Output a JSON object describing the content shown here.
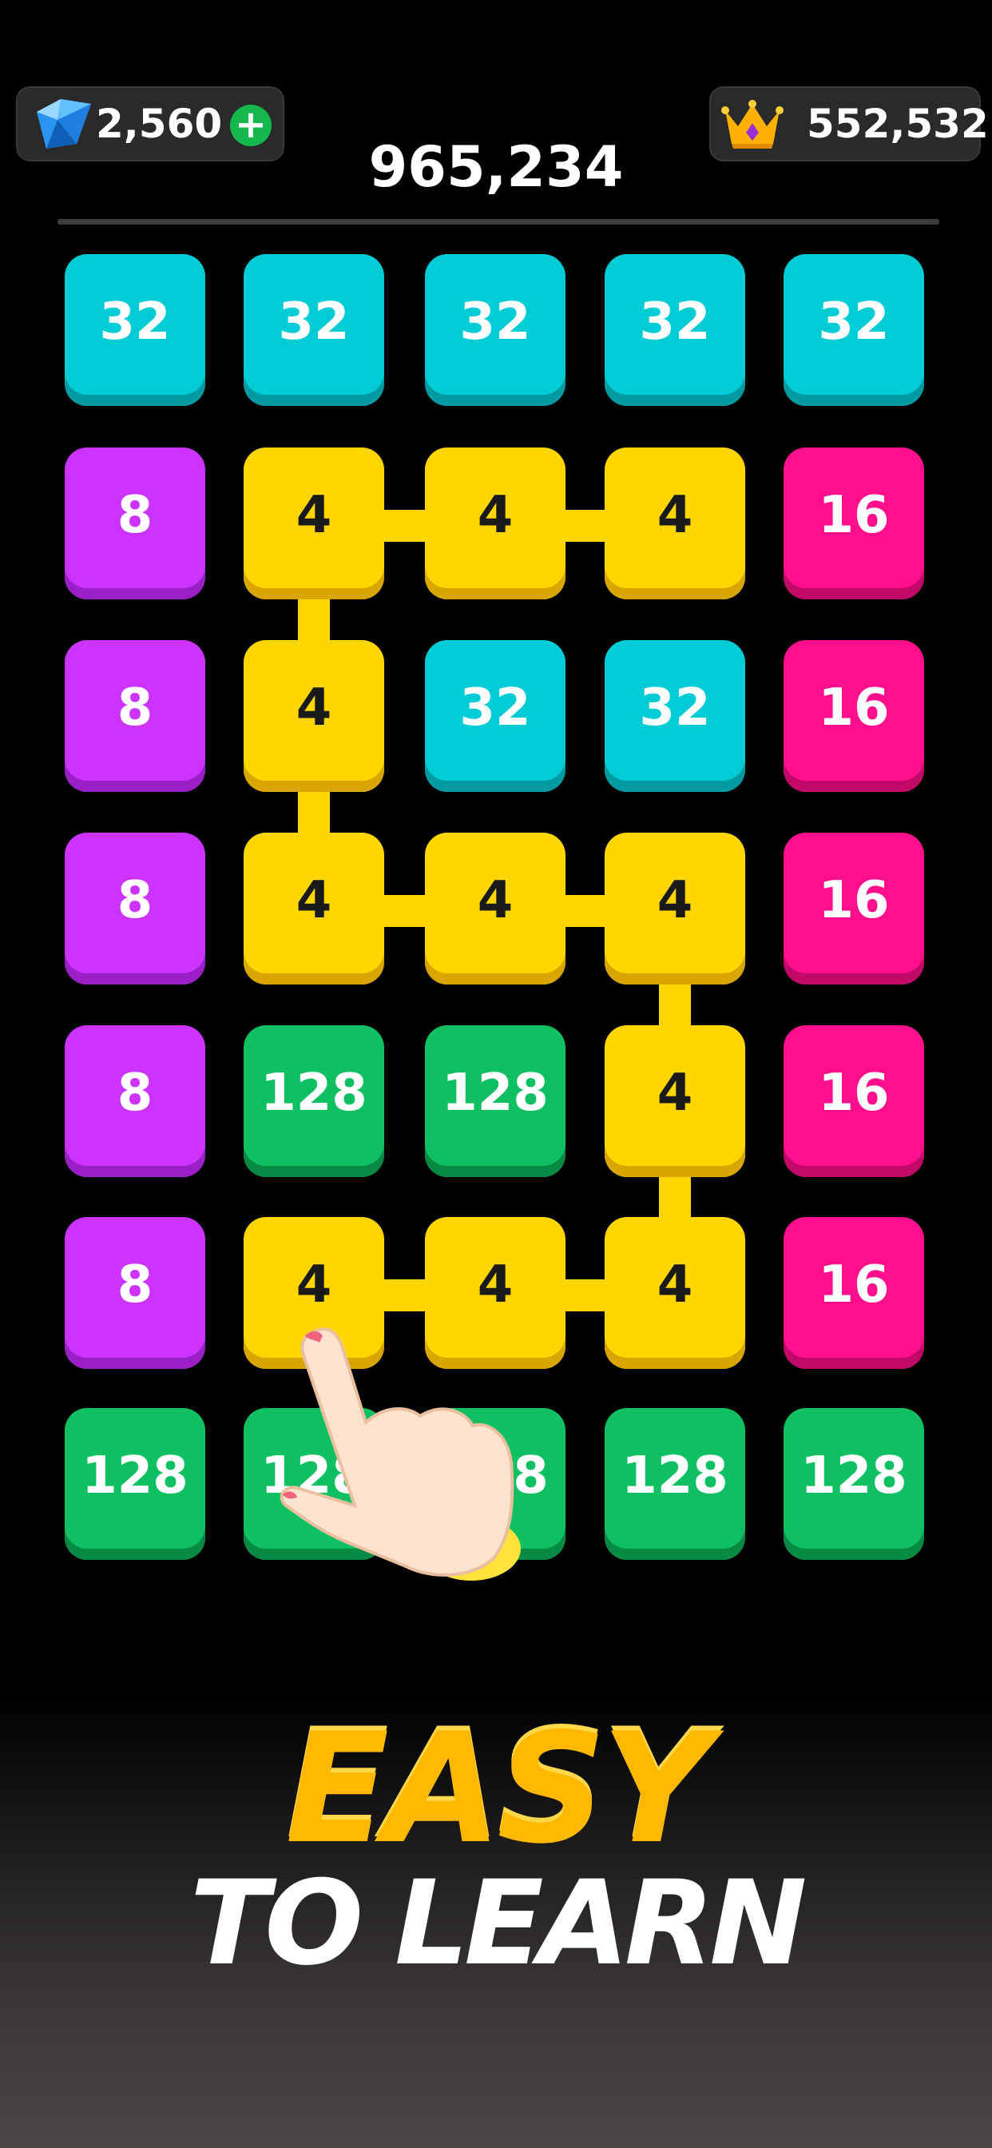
{
  "header": {
    "gems": "2,560",
    "plus": "+",
    "best": "552,532",
    "score": "965,234"
  },
  "board": {
    "rows": [
      [
        "32",
        "32",
        "32",
        "32",
        "32"
      ],
      [
        "8",
        "4",
        "4",
        "4",
        "16"
      ],
      [
        "8",
        "4",
        "32",
        "32",
        "16"
      ],
      [
        "8",
        "4",
        "4",
        "4",
        "16"
      ],
      [
        "8",
        "128",
        "128",
        "4",
        "16"
      ],
      [
        "8",
        "4",
        "4",
        "4",
        "16"
      ],
      [
        "128",
        "128",
        "128",
        "128",
        "128"
      ]
    ],
    "path": [
      [
        1,
        3
      ],
      [
        1,
        2
      ],
      [
        1,
        1
      ],
      [
        2,
        1
      ],
      [
        3,
        1
      ],
      [
        3,
        2
      ],
      [
        3,
        3
      ],
      [
        4,
        3
      ],
      [
        5,
        3
      ],
      [
        5,
        2
      ],
      [
        5,
        1
      ]
    ]
  },
  "tile_colors": {
    "4": {
      "bg": "#ffd600",
      "shade": "#d9a600",
      "text": "#1a1a1a"
    },
    "8": {
      "bg": "#cc33ff",
      "shade": "#9a1fc7",
      "text": "#ffffff"
    },
    "16": {
      "bg": "#ff0f8c",
      "shade": "#c10a68",
      "text": "#ffffff"
    },
    "32": {
      "bg": "#00ccd6",
      "shade": "#009aa3",
      "text": "#ffffff"
    },
    "128": {
      "bg": "#0ec061",
      "shade": "#078a44",
      "text": "#ffffff"
    }
  },
  "caption": {
    "line1": "EASY",
    "line2": "TO LEARN"
  },
  "icons": {
    "gem": "gem-icon",
    "crown": "crown-icon",
    "hand": "pointing-hand-icon"
  }
}
